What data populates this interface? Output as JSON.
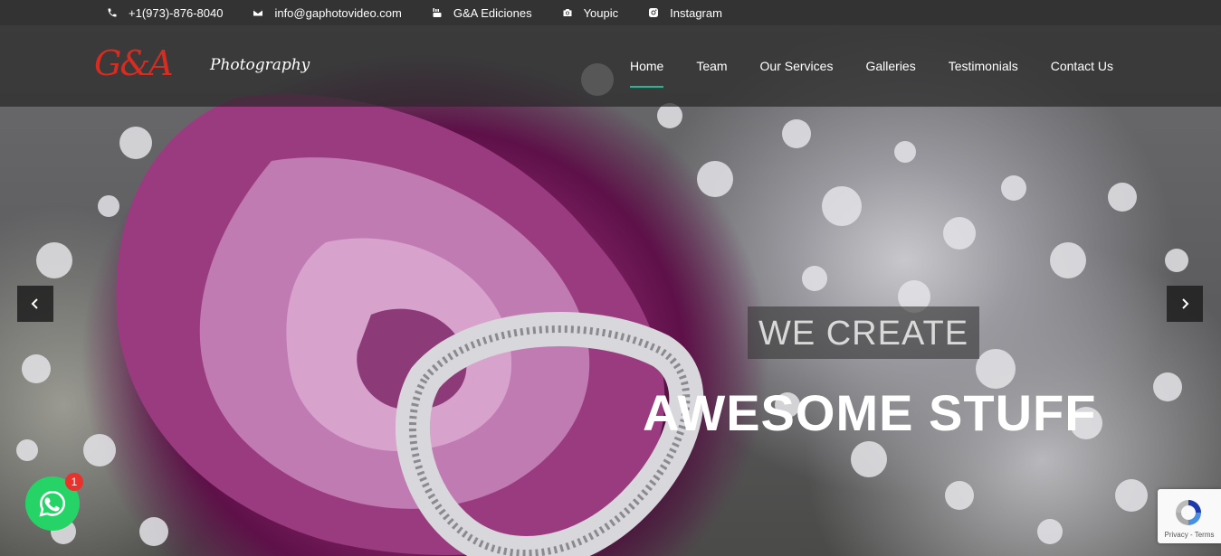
{
  "topbar": {
    "items": [
      {
        "icon": "phone-icon",
        "label": "+1(973)-876-8040"
      },
      {
        "icon": "envelope-icon",
        "label": "info@gaphotovideo.com"
      },
      {
        "icon": "youtube-icon",
        "label": "G&A Ediciones"
      },
      {
        "icon": "camera-icon",
        "label": "Youpic"
      },
      {
        "icon": "instagram-icon",
        "label": "Instagram"
      }
    ]
  },
  "header": {
    "logo_main": "G&A",
    "logo_sub": "Photography",
    "nav": [
      {
        "label": "Home",
        "active": true
      },
      {
        "label": "Team"
      },
      {
        "label": "Our Services"
      },
      {
        "label": "Galleries"
      },
      {
        "label": "Testimonials"
      },
      {
        "label": "Contact Us"
      }
    ]
  },
  "slider": {
    "caption_small": "WE CREATE",
    "caption_large": "AWESOME STUFF"
  },
  "whatsapp": {
    "badge_count": "1"
  },
  "recaptcha": {
    "label": "Privacy - Terms"
  },
  "colors": {
    "accent": "#1abc9c",
    "logo_red": "#d92b1f",
    "whatsapp_green": "#25d366",
    "topbar_bg": "#333333"
  }
}
